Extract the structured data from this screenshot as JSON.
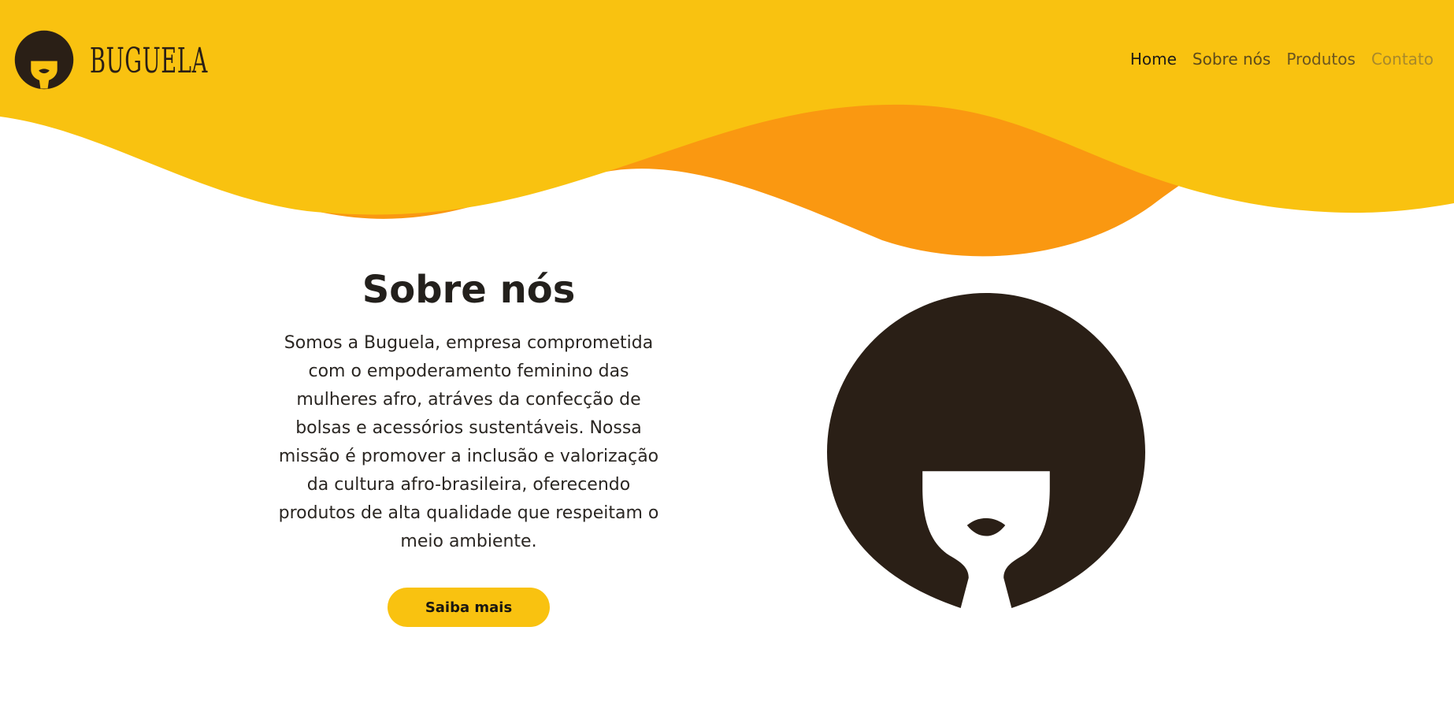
{
  "brand": {
    "name": "BUGUELA",
    "logo_icon": "afro-woman-logo-icon"
  },
  "nav": {
    "items": [
      {
        "label": "Home",
        "state": "active"
      },
      {
        "label": "Sobre nós",
        "state": "normal"
      },
      {
        "label": "Produtos",
        "state": "normal"
      },
      {
        "label": "Contato",
        "state": "faded"
      }
    ]
  },
  "about": {
    "title": "Sobre nós",
    "text": "Somos a Buguela, empresa comprometida com o empoderamento feminino das mulheres afro, atráves da confecção de bolsas e acessórios sustentáveis. Nossa missão é promover a inclusão e valorização da cultura afro-brasileira, oferecendo produtos de alta qualidade que respeitam o meio ambiente.",
    "button_label": "Saiba mais"
  },
  "illustration": {
    "icon": "afro-woman-illustration-icon"
  },
  "colors": {
    "yellow": "#f9c210",
    "orange": "#fa9811",
    "dark_brown": "#2a1f16",
    "background": "#ffffff"
  }
}
